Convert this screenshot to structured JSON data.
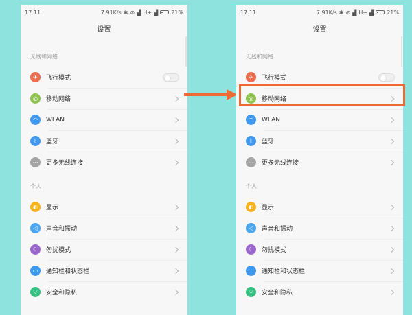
{
  "status_bar": {
    "time": "17:11",
    "speed": "7.91K/s",
    "signal_text": "H+",
    "battery": "21%"
  },
  "header": {
    "title": "设置"
  },
  "sections": {
    "wireless": "无线和网络",
    "personal": "个人"
  },
  "items": [
    {
      "label": "飞行模式",
      "icon": "airplane-icon",
      "color": "#ee6b4d"
    },
    {
      "label": "移动网络",
      "icon": "mobile-network-icon",
      "color": "#8ec44f"
    },
    {
      "label": "WLAN",
      "icon": "wifi-icon",
      "color": "#3f98ee"
    },
    {
      "label": "蓝牙",
      "icon": "bluetooth-icon",
      "color": "#3f98ee"
    },
    {
      "label": "更多无线连接",
      "icon": "more-icon",
      "color": "#a4a4a4"
    },
    {
      "label": "显示",
      "icon": "display-icon",
      "color": "#f6b21a"
    },
    {
      "label": "声音和振动",
      "icon": "sound-icon",
      "color": "#4aa6ee"
    },
    {
      "label": "勿扰模式",
      "icon": "moon-icon",
      "color": "#9b66cc"
    },
    {
      "label": "通知栏和状态栏",
      "icon": "notification-icon",
      "color": "#3f98ee"
    },
    {
      "label": "安全和隐私",
      "icon": "shield-icon",
      "color": "#35c080"
    }
  ],
  "colors": {
    "background": "#8fe3df",
    "highlight": "#ee6a35"
  }
}
